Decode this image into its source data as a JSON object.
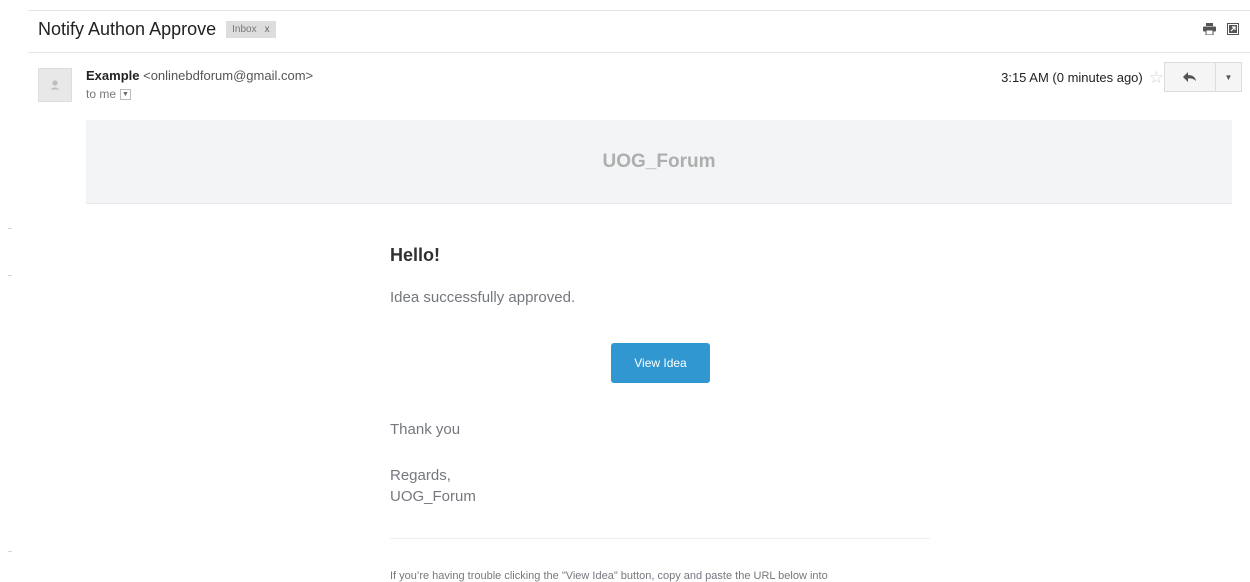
{
  "thread": {
    "subject": "Notify Authon Approve",
    "label": "Inbox",
    "label_remove": "x",
    "actions": [
      {
        "icon": "print-icon"
      },
      {
        "icon": "new-window-icon"
      }
    ]
  },
  "message": {
    "sender_name": "Example",
    "sender_email": "<onlinebdforum@gmail.com>",
    "recipient": "to me",
    "time": "3:15 AM (0 minutes ago)",
    "avatar_icon": "person-icon",
    "star_icon": "star-icon",
    "reply_icon": "reply-icon",
    "more_icon": "chevron-down-icon"
  },
  "email": {
    "brand": "UOG_Forum",
    "greeting": "Hello!",
    "intro": "Idea successfully approved.",
    "action_label": "View Idea",
    "thanks": "Thank you",
    "regards": "Regards,",
    "signature": "UOG_Forum",
    "trouble": "If you’re having trouble clicking the \"View Idea\" button, copy and paste the URL below into"
  },
  "colors": {
    "accent_button": "#3097d1",
    "banner_bg": "#f2f4f6",
    "brand_text": "#aeaeae",
    "body_text": "#74787e"
  }
}
